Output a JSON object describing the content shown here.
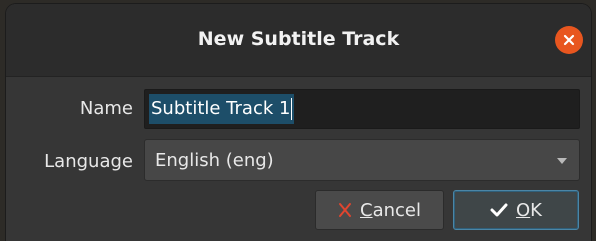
{
  "dialog": {
    "title": "New Subtitle Track"
  },
  "form": {
    "name_label": "Name",
    "name_value": "Subtitle Track 1",
    "language_label": "Language",
    "language_value": "English (eng)"
  },
  "buttons": {
    "cancel_mnemonic": "C",
    "cancel_rest": "ancel",
    "ok_mnemonic": "O",
    "ok_rest": "K"
  },
  "icons": {
    "close": "close-icon",
    "cancel": "cancel-x-icon",
    "ok": "checkmark-icon",
    "dropdown": "chevron-down-icon"
  },
  "colors": {
    "accent": "#e8561f",
    "selection": "#1d4e69",
    "cancel_icon": "#e0452f",
    "default_border": "#4b86a6"
  }
}
